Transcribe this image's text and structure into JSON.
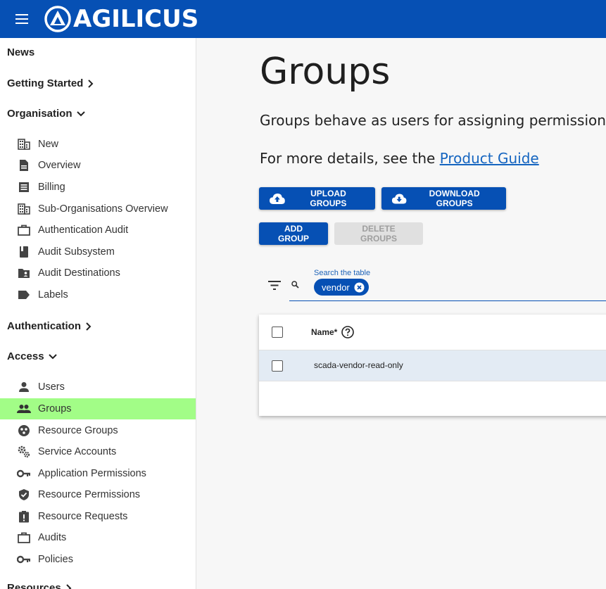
{
  "header": {
    "brand": "AGILICUS"
  },
  "sidebar": {
    "news": "News",
    "getting_started": "Getting Started",
    "organisation": "Organisation",
    "org_items": [
      "New",
      "Overview",
      "Billing",
      "Sub-Organisations Overview",
      "Authentication Audit",
      "Audit Subsystem",
      "Audit Destinations",
      "Labels"
    ],
    "authentication": "Authentication",
    "access": "Access",
    "access_items": [
      "Users",
      "Groups",
      "Resource Groups",
      "Service Accounts",
      "Application Permissions",
      "Resource Permissions",
      "Resource Requests",
      "Audits",
      "Policies"
    ],
    "resources": "Resources",
    "active_item": "Groups",
    "active_color": "#a2fd87"
  },
  "main": {
    "title": "Groups",
    "description": "Groups behave as users for assigning permissions an",
    "details_prefix": "For more details, see the ",
    "details_link": "Product Guide",
    "buttons": {
      "upload": "UPLOAD GROUPS",
      "download": "DOWNLOAD GROUPS",
      "add": "ADD GROUP",
      "delete": "DELETE GROUPS"
    },
    "search": {
      "label": "Search the table",
      "chip": "vendor"
    },
    "table": {
      "header_name": "Name*",
      "rows": [
        "scada-vendor-read-only"
      ]
    }
  },
  "colors": {
    "brand_blue": "#0650b4",
    "row_highlight": "#e3ebf4"
  }
}
